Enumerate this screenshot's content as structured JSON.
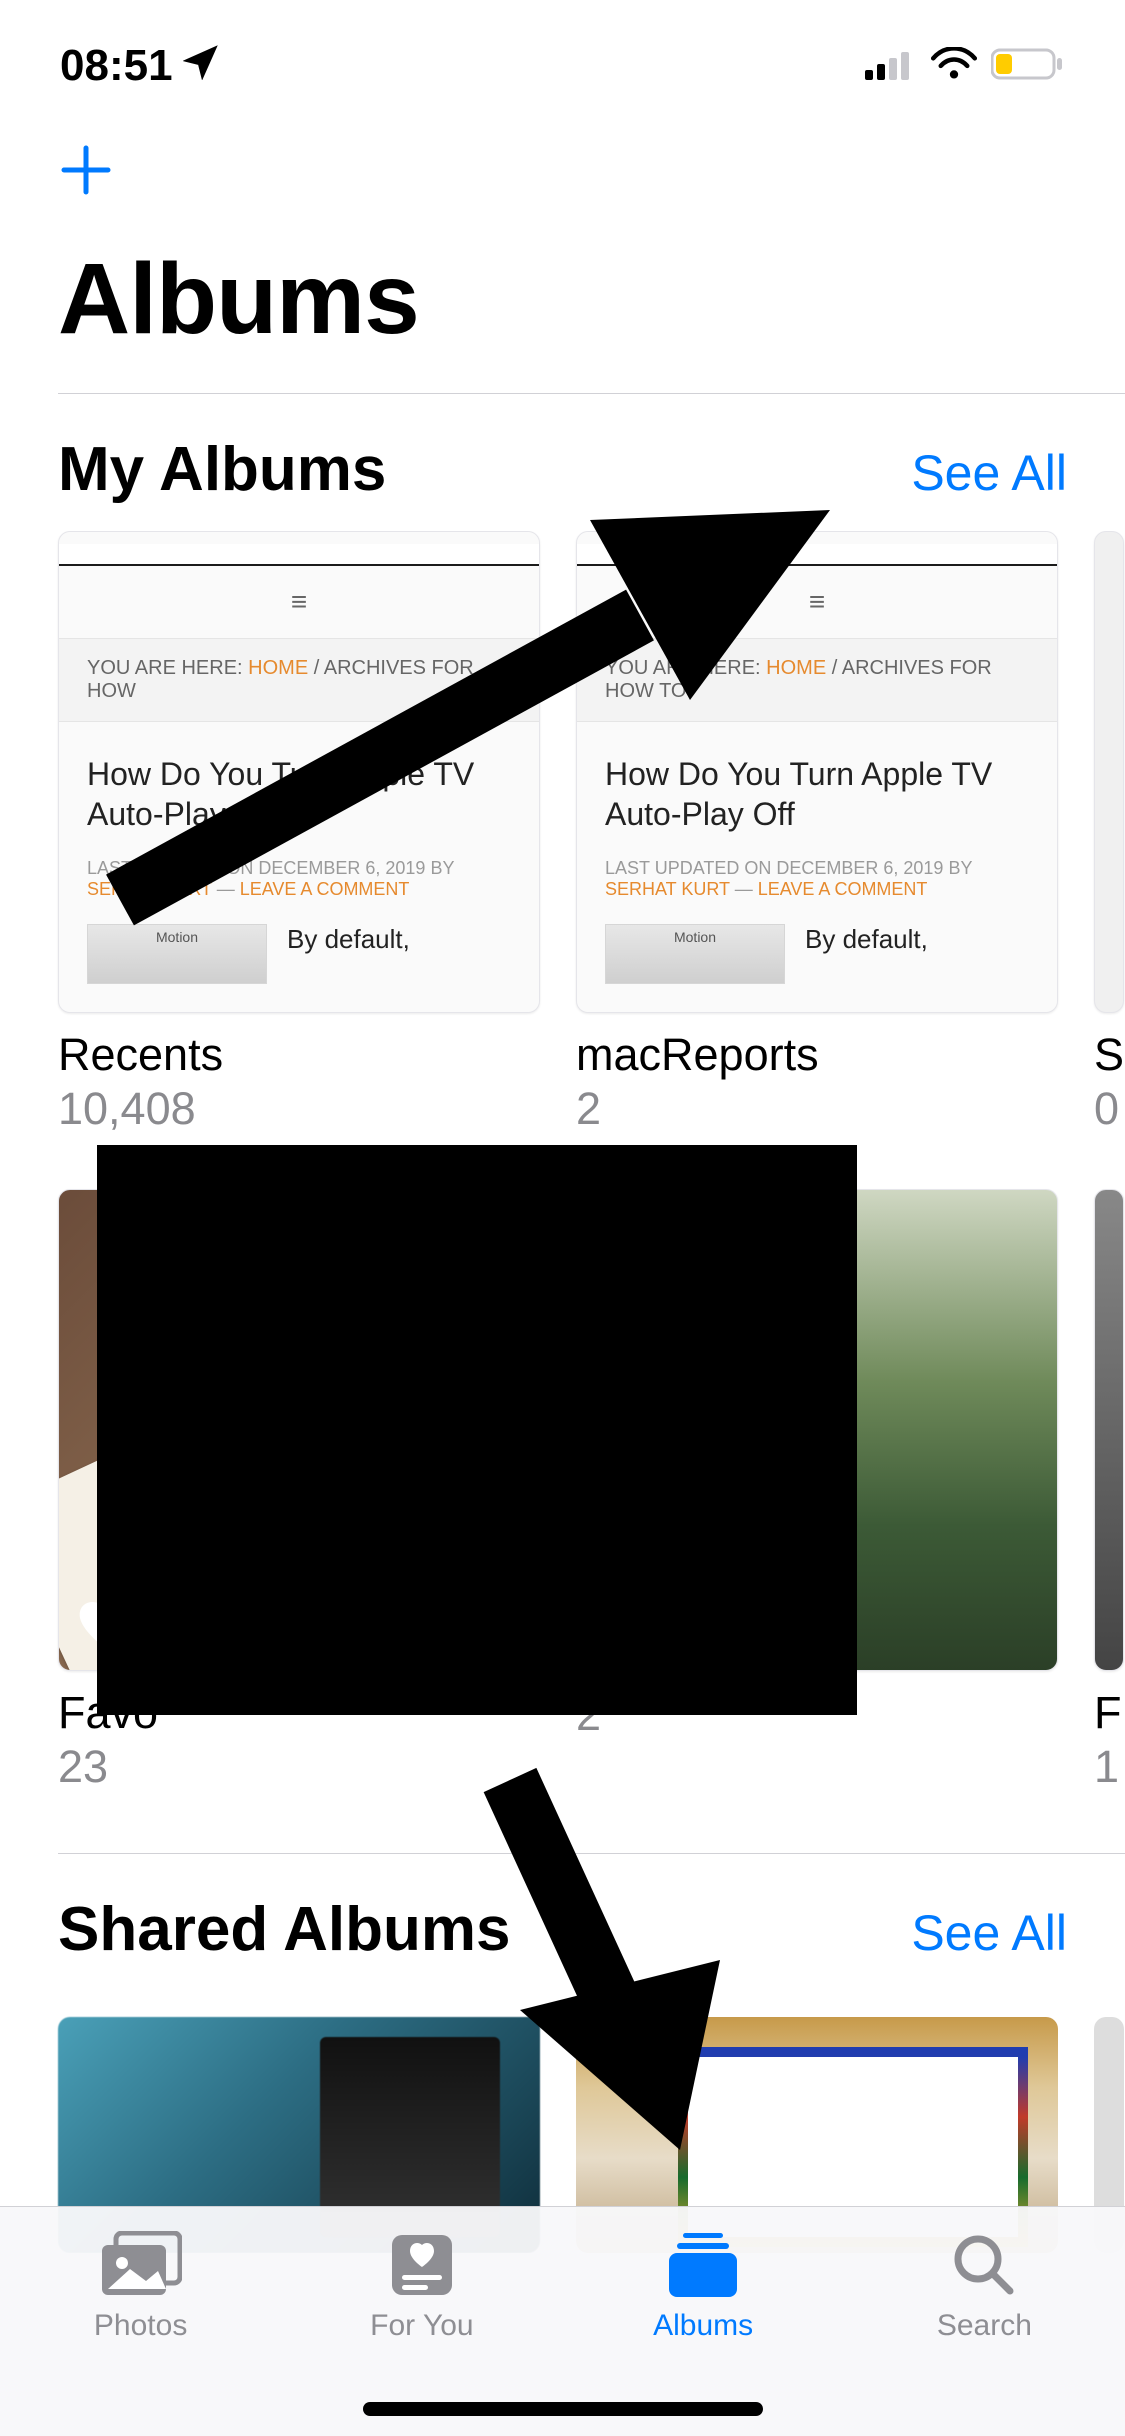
{
  "status": {
    "time": "08:51"
  },
  "nav": {
    "title": "Albums"
  },
  "sections": {
    "my_albums": {
      "title": "My Albums",
      "see_all": "See All",
      "row1": [
        {
          "name": "Recents",
          "count": "10,408"
        },
        {
          "name": "macReports",
          "count": "2"
        },
        {
          "name": "S",
          "count": "0"
        }
      ],
      "row2": [
        {
          "name": "Favo",
          "count": "23"
        },
        {
          "name": "",
          "count": "2"
        },
        {
          "name": "F",
          "count": "1"
        }
      ]
    },
    "shared": {
      "title": "Shared Albums",
      "see_all": "See All"
    }
  },
  "blog_preview": {
    "hamburger": "≡",
    "crumb_prefix": "YOU ARE HERE: ",
    "crumb_home": "HOME",
    "crumb_rest_short": " / ARCHIVES FOR HOW",
    "crumb_rest_full": " / ARCHIVES FOR HOW TO",
    "title_a": "How Do You Turn Apple TV Auto-Play",
    "title_b": "How Do You Turn Apple TV Auto-Play Off",
    "meta_prefix": "LAST UPDATED ON DECEMBER 6, 2019 BY",
    "author": "SERHAT KURT",
    "sep": " — ",
    "comment": "LEAVE A COMMENT",
    "mini_label": "Motion",
    "snippet": "By default,"
  },
  "tabs": {
    "photos": "Photos",
    "for_you": "For You",
    "albums": "Albums",
    "search": "Search"
  }
}
